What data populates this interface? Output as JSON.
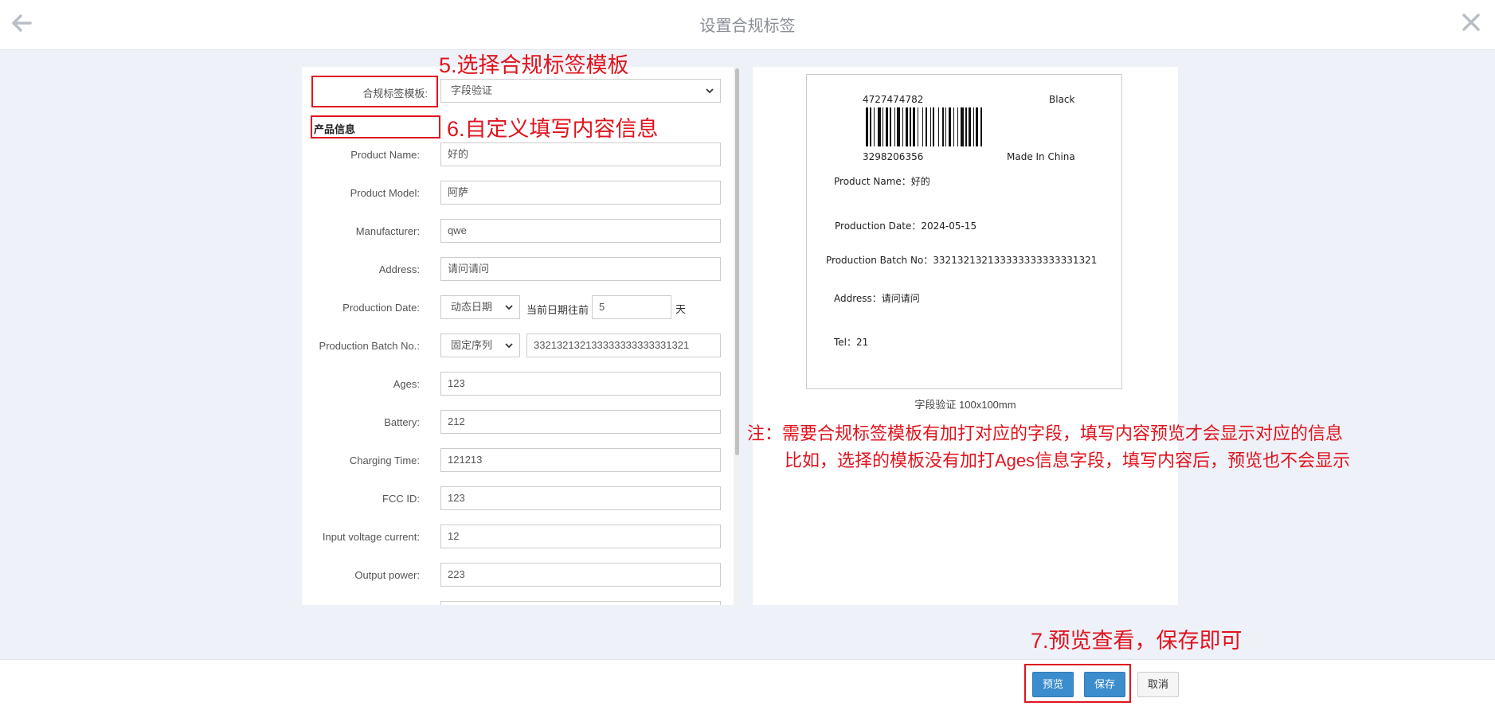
{
  "header": {
    "title": "设置合规标签",
    "back_icon": "arrow-left-icon",
    "close_icon": "close-icon"
  },
  "form": {
    "template_label": "合规标签模板:",
    "template_value": "字段验证",
    "section_title": "产品信息",
    "fields": [
      {
        "label": "Product Name:",
        "value": "好的"
      },
      {
        "label": "Product Model:",
        "value": "阿萨"
      },
      {
        "label": "Manufacturer:",
        "value": "qwe"
      },
      {
        "label": "Address:",
        "value": "请问请问"
      }
    ],
    "production_date": {
      "label": "Production Date:",
      "mode": "动态日期",
      "prefix": "当前日期往前",
      "value": "5",
      "suffix": "天"
    },
    "batch": {
      "label": "Production Batch No.:",
      "mode": "固定序列",
      "value": "332132132133333333333331321"
    },
    "fields2": [
      {
        "label": "Ages:",
        "value": "123"
      },
      {
        "label": "Battery:",
        "value": "212"
      },
      {
        "label": "Charging Time:",
        "value": "121213"
      },
      {
        "label": "FCC ID:",
        "value": "123"
      },
      {
        "label": "Input voltage current:",
        "value": "12"
      },
      {
        "label": "Output power:",
        "value": "223"
      }
    ]
  },
  "preview": {
    "barcode_top_left": "4727474782",
    "barcode_top_right": "Black",
    "barcode_bottom_left": "3298206356",
    "barcode_bottom_right": "Made In China",
    "product_name": "Product Name：好的",
    "production_date": "Production Date：2024-05-15",
    "batch": "Production Batch No：332132132133333333333331321",
    "address": "Address：请问请问",
    "tel": "Tel：21",
    "caption": "字段验证 100x100mm"
  },
  "annotations": {
    "step5": "5.选择合规标签模板",
    "step6": "6.自定义填写内容信息",
    "step7": "7.预览查看，保存即可",
    "note_line1": "注：需要合规标签模板有加打对应的字段，填写内容预览才会显示对应的信息",
    "note_line2": "比如，选择的模板没有加打Ages信息字段，填写内容后，预览也不会显示"
  },
  "footer": {
    "preview_label": "预览",
    "save_label": "保存",
    "cancel_label": "取消"
  },
  "colors": {
    "accent": "#3c8dcd",
    "annotation": "#e0141e",
    "background": "#eef1f8"
  }
}
